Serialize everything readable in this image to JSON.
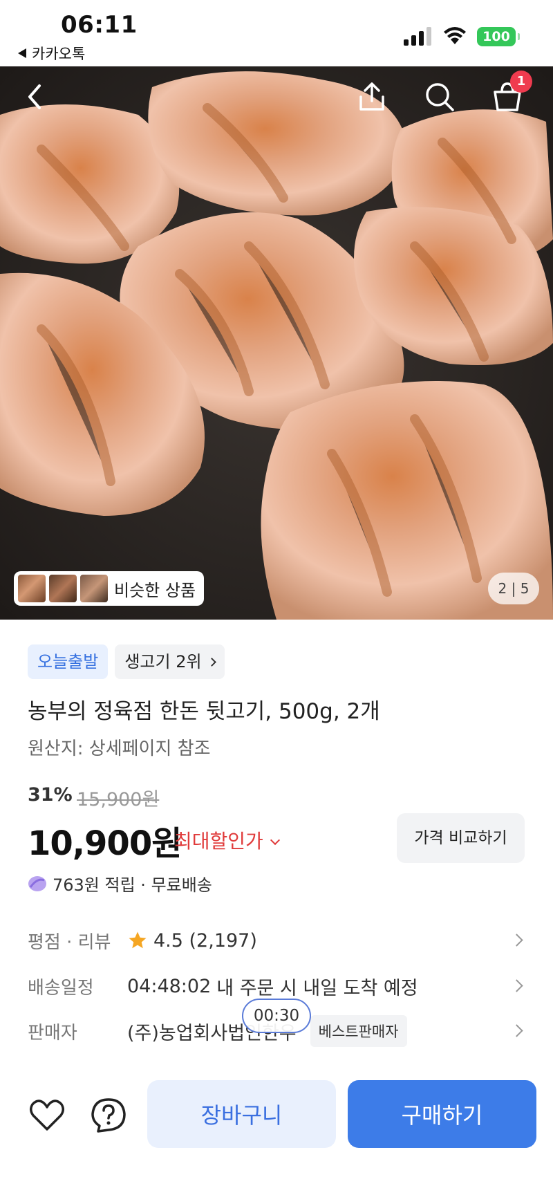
{
  "status_bar": {
    "time": "06:11",
    "back_app": "카카오톡",
    "battery": "100"
  },
  "hero": {
    "cart_count": "1",
    "similar_label": "비슷한 상품",
    "pager": "2 | 5",
    "icons": [
      "back-icon",
      "share-icon",
      "search-icon",
      "cart-icon"
    ]
  },
  "product": {
    "tags": [
      "오늘출발",
      "생고기 2위"
    ],
    "title": "농부의 정육점 한돈 뒷고기, 500g, 2개",
    "origin": "원산지: 상세페이지 참조",
    "discount": "31%",
    "original_price": "15,900원",
    "price": "10,900원",
    "lowest_price_label": "최대할인가",
    "compare_button": "가격 비교하기",
    "points": "763원 적립 · 무료배송"
  },
  "details": {
    "rating_label": "평점 · 리뷰",
    "rating_value": "4.5 (2,197)",
    "delivery_label": "배송일정",
    "delivery_countdown": "04:48:02",
    "delivery_text": "내 주문 시 내일 도착 예정",
    "seller_label": "판매자",
    "seller_name": "(주)농업회사법인한우",
    "seller_badge": "베스트판매자",
    "timer": "00:30"
  },
  "actions": {
    "cart": "장바구니",
    "buy": "구매하기"
  },
  "colors": {
    "accent": "#3d7ce8",
    "sale": "#e03b3b",
    "badge": "#ef3b4f",
    "star": "#f5a623"
  }
}
